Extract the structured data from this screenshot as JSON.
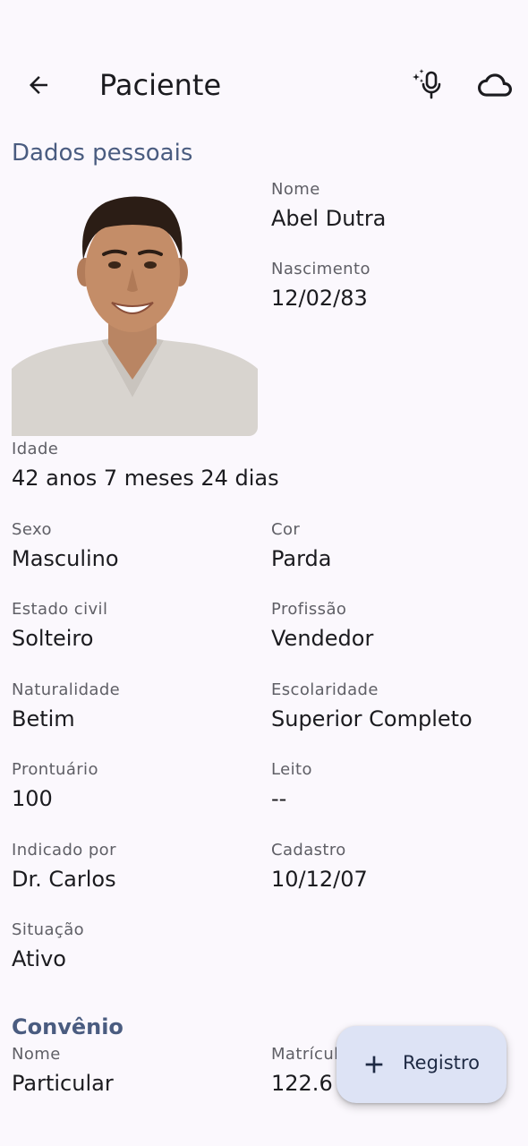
{
  "topbar": {
    "title": "Paciente",
    "icons": [
      "back-arrow-icon",
      "ai-mic-icon",
      "cloud-icon"
    ]
  },
  "sections": {
    "personal": "Dados pessoais",
    "insurance": "Convênio"
  },
  "patient": {
    "photo_icon": "patient-photo",
    "name": {
      "label": "Nome",
      "value": "Abel Dutra"
    },
    "birth": {
      "label": "Nascimento",
      "value": "12/02/83"
    },
    "age": {
      "label": "Idade",
      "value": "42 anos 7 meses 24 dias"
    },
    "sex": {
      "label": "Sexo",
      "value": "Masculino"
    },
    "color": {
      "label": "Cor",
      "value": "Parda"
    },
    "marital": {
      "label": "Estado civil",
      "value": "Solteiro"
    },
    "profession": {
      "label": "Profissão",
      "value": "Vendedor"
    },
    "birthplace": {
      "label": "Naturalidade",
      "value": "Betim"
    },
    "education": {
      "label": "Escolaridade",
      "value": "Superior Completo"
    },
    "record": {
      "label": "Prontuário",
      "value": "100"
    },
    "bed": {
      "label": "Leito",
      "value": "--"
    },
    "referred": {
      "label": "Indicado por",
      "value": "Dr. Carlos"
    },
    "registered": {
      "label": "Cadastro",
      "value": "10/12/07"
    },
    "status": {
      "label": "Situação",
      "value": "Ativo"
    }
  },
  "insurance": {
    "name": {
      "label": "Nome",
      "value": "Particular"
    },
    "id": {
      "label": "Matrícula",
      "value": "122.6"
    }
  },
  "fab": {
    "label": "Registro",
    "icon": "plus-icon"
  },
  "colors": {
    "background": "#fbf8fd",
    "accent": "#4a5c80",
    "fab": "#dde3f5"
  }
}
